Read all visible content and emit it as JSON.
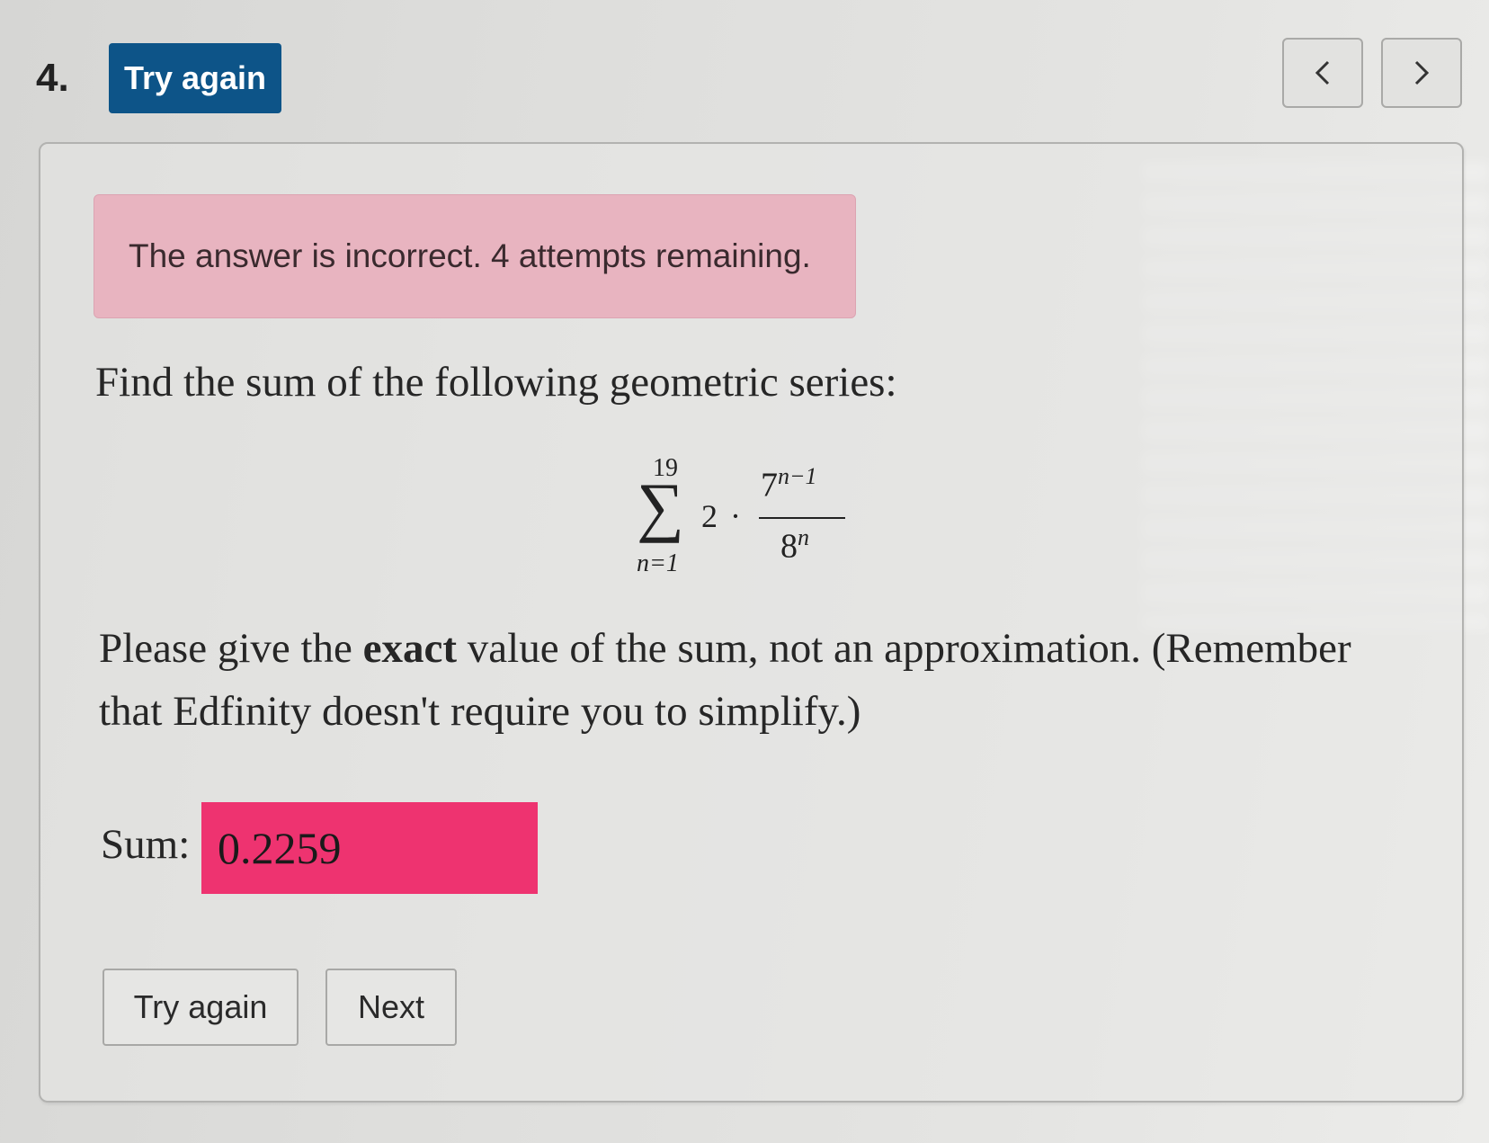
{
  "question": {
    "number": "4.",
    "status_button_label": "Try again"
  },
  "nav": {
    "prev_icon": "chevron-left-icon",
    "next_icon": "chevron-right-icon"
  },
  "feedback": {
    "message": "The answer is incorrect. 4 attempts remaining.",
    "color": "#e8b4c0"
  },
  "problem": {
    "prompt": "Find the sum of the following geometric series:",
    "series": {
      "upper_limit": "19",
      "lower_limit": "n=1",
      "coefficient": "2",
      "operator": "·",
      "numerator_base": "7",
      "numerator_exponent": "n−1",
      "denominator_base": "8",
      "denominator_exponent": "n"
    },
    "instruction_before": "Please give the ",
    "instruction_emphasis": "exact",
    "instruction_after": " value of the sum, not an approximation. (Remember that Edfinity doesn't require you to simplify.)"
  },
  "answer": {
    "label": "Sum:",
    "value": "0.2259",
    "state_color": "#ee3370"
  },
  "actions": {
    "try_again_label": "Try again",
    "next_label": "Next"
  },
  "colors": {
    "primary": "#0d5488"
  }
}
